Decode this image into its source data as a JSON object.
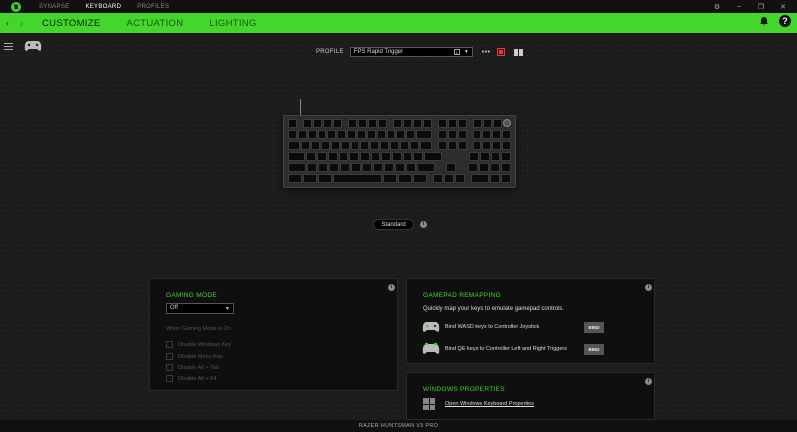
{
  "topnav": {
    "items": [
      "SYNAPSE",
      "KEYBOARD",
      "PROFILES"
    ],
    "active": 1
  },
  "window_controls": {
    "settings": "⚙",
    "minimize": "–",
    "maximize": "❐",
    "close": "✕"
  },
  "tabs": {
    "items": [
      "CUSTOMIZE",
      "ACTUATION",
      "LIGHTING"
    ],
    "active": 0
  },
  "nav": {
    "back": "‹",
    "forward": "›"
  },
  "header_icons": {
    "bell": "🔔",
    "help": "?"
  },
  "profile": {
    "label": "PROFILE",
    "value": "FPS Rapid Trigger",
    "badge": "1",
    "more": "•••"
  },
  "mode_pill": "Standard",
  "gaming_mode": {
    "title": "GAMING MODE",
    "selected": "Off",
    "subheading": "When Gaming Mode is On",
    "options": [
      "Disable Windows Key",
      "Disable Menu Key",
      "Disable Alt + Tab",
      "Disable Alt + F4"
    ]
  },
  "gamepad": {
    "title": "GAMEPAD REMAPPING",
    "description": "Quickly map your keys to emulate gamepad controls.",
    "rows": [
      {
        "label": "Bind WASD keys to Controller Joystick",
        "button": "BIND"
      },
      {
        "label": "Bind QE keys to Controller Left and Right Triggers",
        "button": "BIND"
      }
    ]
  },
  "windows_props": {
    "title": "WINDOWS PROPERTIES",
    "link": "Open Windows Keyboard Properties"
  },
  "footer": {
    "device": "RAZER HUNTSMAN V3 PRO"
  },
  "colors": {
    "accent": "#44d62c",
    "background": "#1a1a1a",
    "panel": "#0f0f0f",
    "record": "#ee3333"
  },
  "icons": [
    "razer-logo-icon",
    "hamburger-icon",
    "gamepad-icon",
    "bell-icon",
    "help-icon",
    "record-icon",
    "book-icon",
    "info-icon",
    "windows-icon"
  ]
}
